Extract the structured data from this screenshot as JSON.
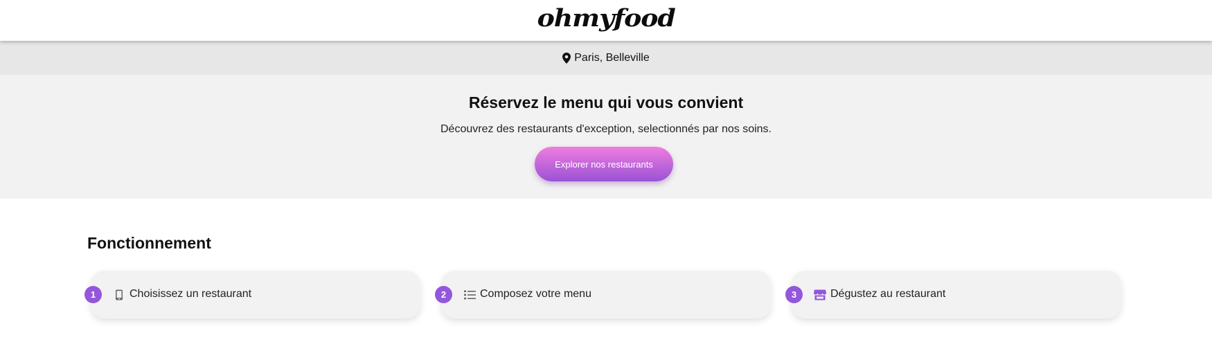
{
  "header": {
    "logo_text": "ohmyfood"
  },
  "location": {
    "icon": "map-pin-icon",
    "text": "Paris, Belleville"
  },
  "hero": {
    "title": "Réservez le menu qui vous convient",
    "subtitle": "Découvrez des restaurants d'exception, selectionnés par nos soins.",
    "button_label": "Explorer nos restaurants"
  },
  "how_it_works": {
    "title": "Fonctionnement",
    "steps": [
      {
        "number": "1",
        "icon": "mobile-phone-icon",
        "label": "Choisissez un restaurant"
      },
      {
        "number": "2",
        "icon": "list-icon",
        "label": "Composez votre menu"
      },
      {
        "number": "3",
        "icon": "store-icon",
        "label": "Dégustez au restaurant"
      }
    ]
  },
  "colors": {
    "accent_purple": "#9356dc",
    "gradient_pink": "#f07ddf",
    "gradient_purple": "#9a52d6",
    "hero_background": "#f2f2f2",
    "location_background": "#e7e7e7"
  }
}
